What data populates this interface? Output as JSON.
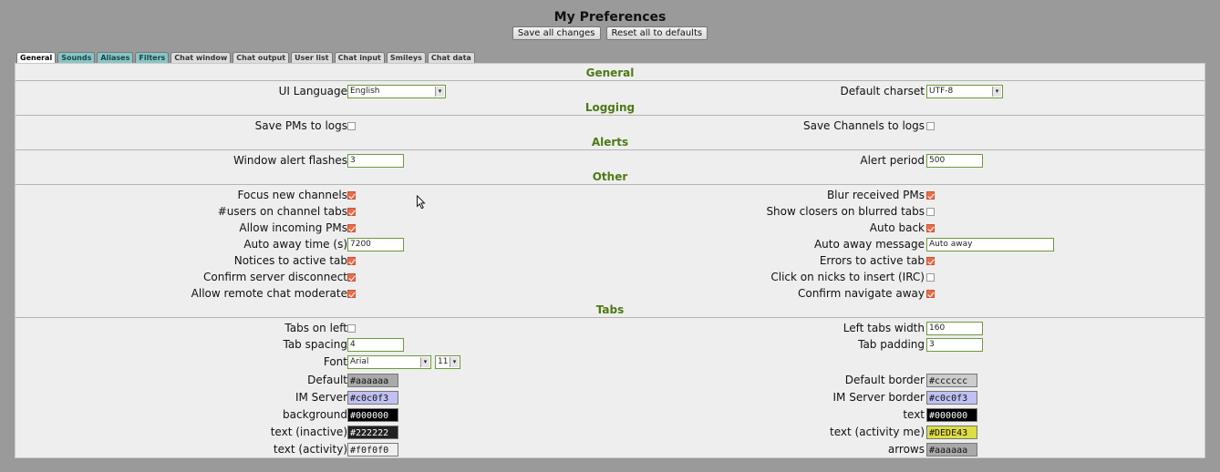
{
  "header": {
    "title": "My Preferences",
    "save_all": "Save all changes",
    "reset_all": "Reset all to defaults"
  },
  "tabs": [
    {
      "label": "General",
      "active": true
    },
    {
      "label": "Sounds"
    },
    {
      "label": "Aliases"
    },
    {
      "label": "Filters"
    },
    {
      "label": "Chat window"
    },
    {
      "label": "Chat output"
    },
    {
      "label": "User list"
    },
    {
      "label": "Chat input"
    },
    {
      "label": "Smileys"
    },
    {
      "label": "Chat data"
    }
  ],
  "sections": {
    "general": "General",
    "logging": "Logging",
    "alerts": "Alerts",
    "other": "Other",
    "tabs": "Tabs"
  },
  "general": {
    "ui_language_label": "UI Language",
    "ui_language_value": "English",
    "default_charset_label": "Default charset",
    "default_charset_value": "UTF-8"
  },
  "logging": {
    "save_pms_label": "Save PMs to logs",
    "save_pms": false,
    "save_channels_label": "Save Channels to logs",
    "save_channels": false
  },
  "alerts": {
    "window_alert_label": "Window alert flashes",
    "window_alert_value": "3",
    "alert_period_label": "Alert period",
    "alert_period_value": "500"
  },
  "other": {
    "focus_new_channels_label": "Focus new channels",
    "blur_received_pms_label": "Blur received PMs",
    "users_on_tabs_label": "#users on channel tabs",
    "show_closers_label": "Show closers on blurred tabs",
    "allow_incoming_pms_label": "Allow incoming PMs",
    "auto_back_label": "Auto back",
    "auto_away_time_label": "Auto away time (s)",
    "auto_away_time_value": "7200",
    "auto_away_message_label": "Auto away message",
    "auto_away_message_value": "Auto away",
    "notices_label": "Notices to active tab",
    "errors_label": "Errors to active tab",
    "confirm_disconnect_label": "Confirm server disconnect",
    "click_nicks_label": "Click on nicks to insert (IRC)",
    "allow_remote_label": "Allow remote chat moderate",
    "confirm_navigate_label": "Confirm navigate away"
  },
  "tabs_section": {
    "tabs_on_left_label": "Tabs on left",
    "left_tabs_width_label": "Left tabs width",
    "left_tabs_width_value": "160",
    "tab_spacing_label": "Tab spacing",
    "tab_spacing_value": "4",
    "tab_padding_label": "Tab padding",
    "tab_padding_value": "3",
    "font_label": "Font",
    "font_value": "Arial",
    "font_size_value": "11",
    "default_label": "Default",
    "default_value": "#aaaaaa",
    "default_border_label": "Default border",
    "default_border_value": "#cccccc",
    "im_server_label": "IM Server",
    "im_server_value": "#c0c0f3",
    "im_server_border_label": "IM Server border",
    "im_server_border_value": "#c0c0f3",
    "background_label": "background",
    "background_value": "#000000",
    "text_label": "text",
    "text_value": "#000000",
    "text_inactive_label": "text (inactive)",
    "text_inactive_value": "#222222",
    "text_activity_me_label": "text (activity me)",
    "text_activity_me_value": "#DEDE43",
    "text_activity_label": "text (activity)",
    "text_activity_value": "#f0f0f0",
    "arrows_label": "arrows",
    "arrows_value": "#aaaaaa"
  },
  "icons": {
    "cursor": "mouse-pointer-icon",
    "dropdown": "chevron-down-icon",
    "checkbox_checked_color": "#e96d4a"
  }
}
